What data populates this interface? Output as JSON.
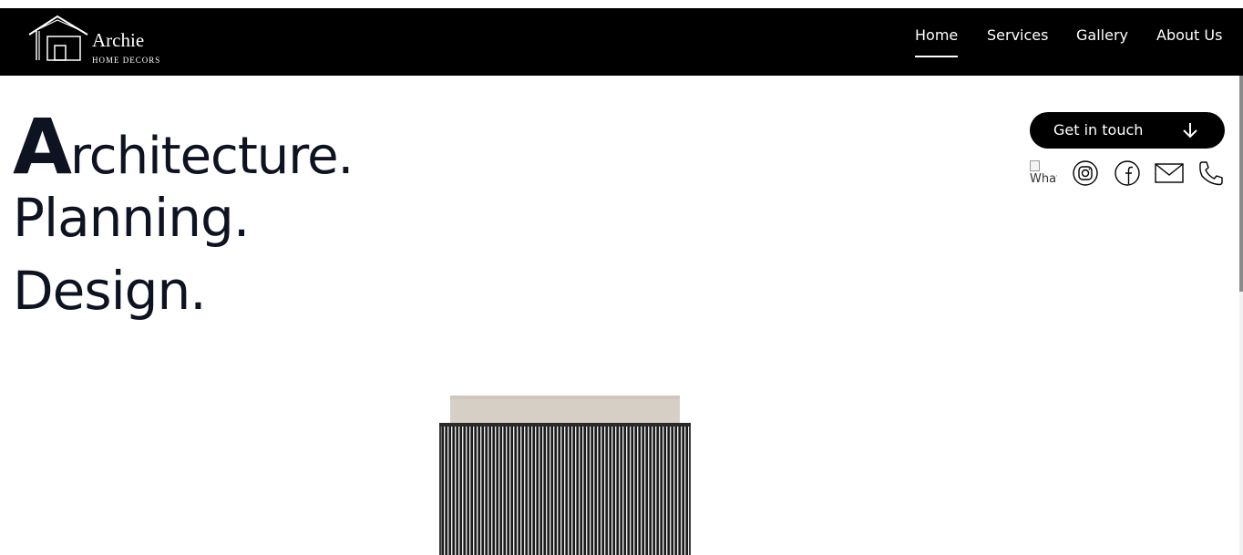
{
  "brand": {
    "name": "Archie",
    "tagline": "HOME DECORS",
    "logo_icon": "house-outline-icon"
  },
  "nav": {
    "items": [
      {
        "label": "Home",
        "active": true
      },
      {
        "label": "Services",
        "active": false
      },
      {
        "label": "Gallery",
        "active": false
      },
      {
        "label": "About Us",
        "active": false
      }
    ]
  },
  "hero": {
    "line1_initial": "A",
    "line1_rest": "rchitecture.",
    "line2": "Planning.",
    "line3": "Design."
  },
  "cta": {
    "label": "Get in touch",
    "icon": "arrow-down-icon"
  },
  "social": {
    "whatsapp_alt": "WhatsApp",
    "icons": [
      "whatsapp-icon",
      "instagram-icon",
      "facebook-icon",
      "mail-icon",
      "phone-icon"
    ]
  },
  "colors": {
    "navbar_bg": "#000000",
    "hero_text": "#0e1322",
    "cta_bg": "#000000",
    "cta_text": "#ffffff"
  }
}
